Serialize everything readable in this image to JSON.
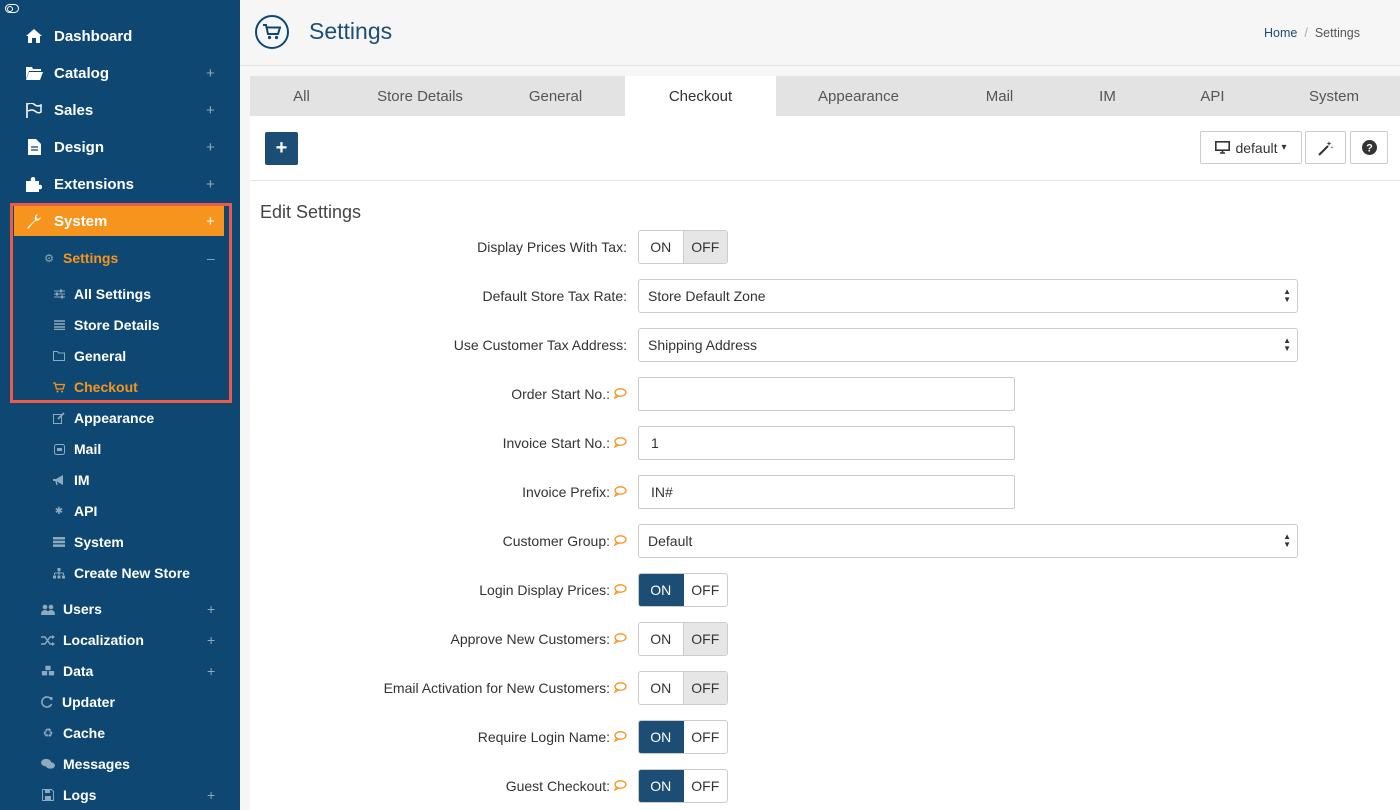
{
  "sidebar": {
    "top_items": [
      {
        "label": "Dashboard",
        "icon": "home-icon"
      },
      {
        "label": "Catalog",
        "icon": "folder-open-icon"
      },
      {
        "label": "Sales",
        "icon": "flag-icon"
      },
      {
        "label": "Design",
        "icon": "file-icon"
      },
      {
        "label": "Extensions",
        "icon": "puzzle-icon"
      }
    ],
    "system": {
      "label": "System",
      "icon": "wrench-icon"
    },
    "settings": {
      "label": "Settings",
      "icon": "gears-icon"
    },
    "settings_children": [
      {
        "label": "All Settings",
        "icon": "sliders-icon"
      },
      {
        "label": "Store Details",
        "icon": "list-icon"
      },
      {
        "label": "General",
        "icon": "folder-icon"
      },
      {
        "label": "Checkout",
        "icon": "cart-icon"
      },
      {
        "label": "Appearance",
        "icon": "edit-icon"
      },
      {
        "label": "Mail",
        "icon": "mail-icon"
      },
      {
        "label": "IM",
        "icon": "bullhorn-icon"
      },
      {
        "label": "API",
        "icon": "asterisk-icon"
      },
      {
        "label": "System",
        "icon": "server-icon"
      },
      {
        "label": "Create New Store",
        "icon": "sitemap-icon"
      }
    ],
    "bottom_items": [
      {
        "label": "Users",
        "icon": "users-icon"
      },
      {
        "label": "Localization",
        "icon": "random-icon"
      },
      {
        "label": "Data",
        "icon": "cubes-icon"
      },
      {
        "label": "Updater",
        "icon": "refresh-icon"
      },
      {
        "label": "Cache",
        "icon": "recycle-icon"
      },
      {
        "label": "Messages",
        "icon": "comments-icon"
      },
      {
        "label": "Logs",
        "icon": "save-icon"
      }
    ],
    "expand_symbol": "+",
    "collapse_symbol": "–"
  },
  "header": {
    "title": "Settings",
    "breadcrumb": {
      "home": "Home",
      "separator": "/",
      "current": "Settings"
    }
  },
  "tabs": [
    "All",
    "Store Details",
    "General",
    "Checkout",
    "Appearance",
    "Mail",
    "IM",
    "API",
    "System"
  ],
  "active_tab": "Checkout",
  "toolbar": {
    "add_label": "+",
    "template_label": "default",
    "template_caret": "▾"
  },
  "form": {
    "section_title": "Edit Settings",
    "on_label": "ON",
    "off_label": "OFF",
    "fields": {
      "display_prices_with_tax": {
        "label": "Display Prices With Tax:",
        "value": "OFF"
      },
      "default_store_tax_rate": {
        "label": "Default Store Tax Rate:",
        "value": "Store Default Zone"
      },
      "use_customer_tax_address": {
        "label": "Use Customer Tax Address:",
        "value": "Shipping Address"
      },
      "order_start_no": {
        "label": "Order Start No.:",
        "value": ""
      },
      "invoice_start_no": {
        "label": "Invoice Start No.:",
        "value": "1"
      },
      "invoice_prefix": {
        "label": "Invoice Prefix:",
        "value": "IN#"
      },
      "customer_group": {
        "label": "Customer Group:",
        "value": "Default"
      },
      "login_display_prices": {
        "label": "Login Display Prices:",
        "value": "ON"
      },
      "approve_new_customers": {
        "label": "Approve New Customers:",
        "value": "OFF"
      },
      "email_activation": {
        "label": "Email Activation for New Customers:",
        "value": "OFF"
      },
      "require_login_name": {
        "label": "Require Login Name:",
        "value": "ON"
      },
      "guest_checkout": {
        "label": "Guest Checkout:",
        "value": "ON"
      }
    }
  },
  "colors": {
    "sidebar_bg": "#0e4872",
    "accent_orange": "#f7941d",
    "primary_blue": "#1c4d74",
    "highlight_frame": "#ec5a4a"
  }
}
